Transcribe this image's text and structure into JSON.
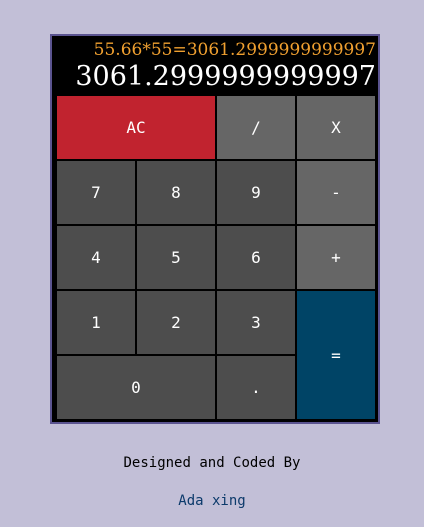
{
  "display": {
    "formula": "55.66*55=3061.2999999999997",
    "output": "3061.2999999999997"
  },
  "keys": {
    "clear": "AC",
    "divide": "/",
    "multiply": "X",
    "seven": "7",
    "eight": "8",
    "nine": "9",
    "subtract": "-",
    "four": "4",
    "five": "5",
    "six": "6",
    "add": "+",
    "one": "1",
    "two": "2",
    "three": "3",
    "equals": "=",
    "zero": "0",
    "decimal": "."
  },
  "footer": {
    "credit": "Designed and Coded By",
    "author": "Ada xing"
  },
  "colors": {
    "background": "#c2bfd7",
    "clear_key": "#c1232f",
    "equals_key": "#004466",
    "number_key": "#4d4d4d",
    "operator_key": "#666666",
    "formula_text": "#f0a030",
    "output_text": "#ffffff",
    "author_text": "#0c3a6b"
  }
}
